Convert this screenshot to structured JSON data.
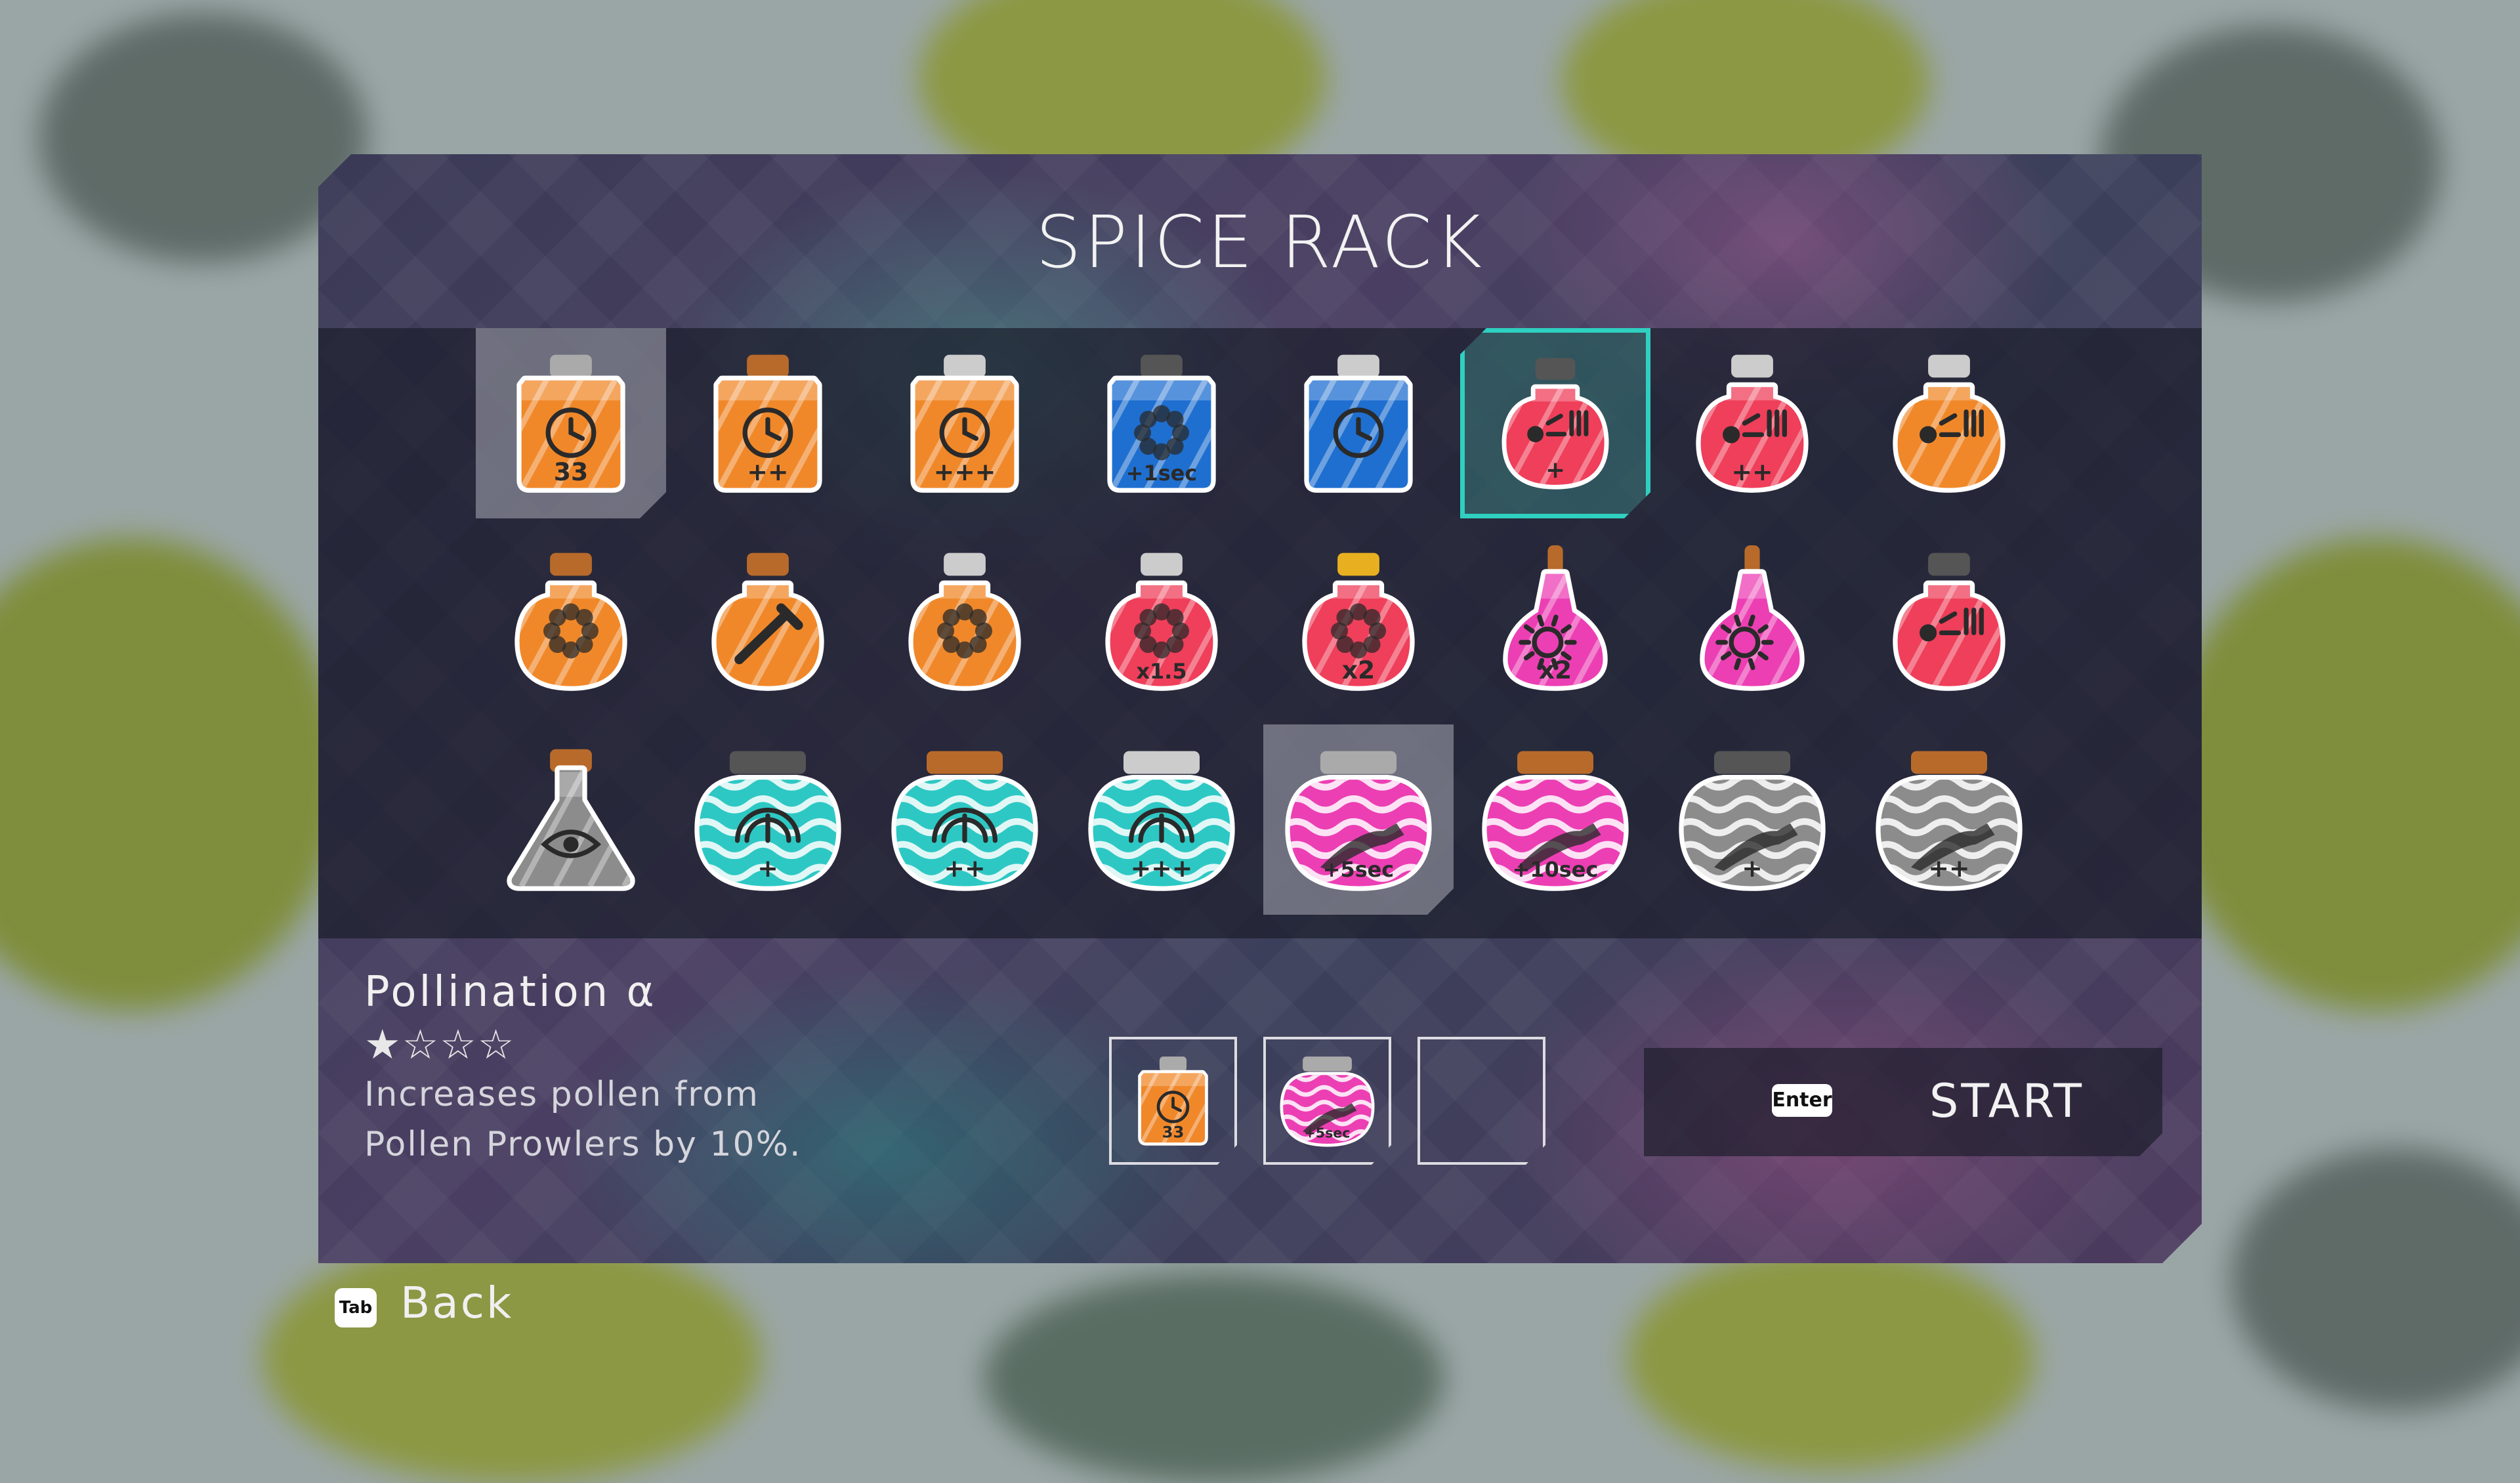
{
  "title": "SPICE RACK",
  "colors": {
    "accent_select": "#2fd0c0",
    "orange_potion": "#f0882a",
    "blue_potion": "#1f6fd0",
    "red_potion": "#ef3f5a",
    "pink_potion": "#ec3fb4",
    "teal_potion": "#2ec8c4",
    "gray_potion": "#8c8c8c"
  },
  "spices": [
    {
      "row": 0,
      "col": 0,
      "shape": "square",
      "color": "#f0882a",
      "cap": "#aaaaaa",
      "icon": "clock-icon",
      "badge": "33",
      "state": "hover"
    },
    {
      "row": 0,
      "col": 1,
      "shape": "square",
      "color": "#f0882a",
      "cap": "#b86a2a",
      "icon": "clock-icon",
      "badge": "++",
      "state": ""
    },
    {
      "row": 0,
      "col": 2,
      "shape": "square",
      "color": "#f0882a",
      "cap": "#cccccc",
      "icon": "clock-icon",
      "badge": "+++",
      "state": ""
    },
    {
      "row": 0,
      "col": 3,
      "shape": "square",
      "color": "#1f6fd0",
      "cap": "#555555",
      "icon": "flower-icon",
      "badge": "+1sec",
      "state": ""
    },
    {
      "row": 0,
      "col": 4,
      "shape": "square",
      "color": "#1f6fd0",
      "cap": "#cccccc",
      "icon": "clock-icon",
      "badge": "",
      "state": ""
    },
    {
      "row": 0,
      "col": 5,
      "shape": "round",
      "color": "#ef3f5a",
      "cap": "#555555",
      "icon": "pollen-icon",
      "badge": "+",
      "state": "selected"
    },
    {
      "row": 0,
      "col": 6,
      "shape": "round",
      "color": "#ef3f5a",
      "cap": "#cccccc",
      "icon": "pollen-icon",
      "badge": "++",
      "state": ""
    },
    {
      "row": 0,
      "col": 7,
      "shape": "round",
      "color": "#f0882a",
      "cap": "#cccccc",
      "icon": "pollen-icon",
      "badge": "",
      "state": ""
    },
    {
      "row": 1,
      "col": 0,
      "shape": "round",
      "color": "#f0882a",
      "cap": "#b86a2a",
      "icon": "flower-icon",
      "badge": "",
      "state": ""
    },
    {
      "row": 1,
      "col": 1,
      "shape": "round",
      "color": "#f0882a",
      "cap": "#b86a2a",
      "icon": "dropper-icon",
      "badge": "",
      "state": ""
    },
    {
      "row": 1,
      "col": 2,
      "shape": "round",
      "color": "#f0882a",
      "cap": "#cccccc",
      "icon": "flower-icon",
      "badge": "",
      "state": ""
    },
    {
      "row": 1,
      "col": 3,
      "shape": "round",
      "color": "#ef3f5a",
      "cap": "#cccccc",
      "icon": "flower-icon",
      "badge": "x1.5",
      "state": ""
    },
    {
      "row": 1,
      "col": 4,
      "shape": "round",
      "color": "#ef3f5a",
      "cap": "#e8b020",
      "icon": "flower-icon",
      "badge": "x2",
      "state": ""
    },
    {
      "row": 1,
      "col": 5,
      "shape": "cone",
      "color": "#ec3fb4",
      "cap": "#b86a2a",
      "icon": "sun-icon",
      "badge": "x2",
      "state": ""
    },
    {
      "row": 1,
      "col": 6,
      "shape": "cone",
      "color": "#ec3fb4",
      "cap": "#b86a2a",
      "icon": "sun-icon",
      "badge": "",
      "state": ""
    },
    {
      "row": 1,
      "col": 7,
      "shape": "round",
      "color": "#ef3f5a",
      "cap": "#555555",
      "icon": "pollen-icon",
      "badge": "",
      "state": ""
    },
    {
      "row": 2,
      "col": 0,
      "shape": "flask",
      "color": "#8c8c8c",
      "cap": "#b86a2a",
      "icon": "eye-icon",
      "badge": "",
      "state": ""
    },
    {
      "row": 2,
      "col": 1,
      "shape": "wide",
      "color": "#2ec8c4",
      "cap": "#555555",
      "icon": "gauge-icon",
      "badge": "+",
      "state": ""
    },
    {
      "row": 2,
      "col": 2,
      "shape": "wide",
      "color": "#2ec8c4",
      "cap": "#b86a2a",
      "icon": "gauge-icon",
      "badge": "++",
      "state": ""
    },
    {
      "row": 2,
      "col": 3,
      "shape": "wide",
      "color": "#2ec8c4",
      "cap": "#cccccc",
      "icon": "gauge-icon",
      "badge": "+++",
      "state": ""
    },
    {
      "row": 2,
      "col": 4,
      "shape": "wide",
      "color": "#ec3fb4",
      "cap": "#aaaaaa",
      "icon": "shoe-icon",
      "badge": "+5sec",
      "state": "hover"
    },
    {
      "row": 2,
      "col": 5,
      "shape": "wide",
      "color": "#ec3fb4",
      "cap": "#b86a2a",
      "icon": "shoe-icon",
      "badge": "+10sec",
      "state": ""
    },
    {
      "row": 2,
      "col": 6,
      "shape": "wide",
      "color": "#8c8c8c",
      "cap": "#555555",
      "icon": "shoe-icon",
      "badge": "+",
      "state": ""
    },
    {
      "row": 2,
      "col": 7,
      "shape": "wide",
      "color": "#8c8c8c",
      "cap": "#b86a2a",
      "icon": "shoe-icon",
      "badge": "++",
      "state": ""
    }
  ],
  "info": {
    "name": "Pollination α",
    "stars": "★☆☆☆",
    "desc_line1": "Increases pollen from",
    "desc_line2": "Pollen Prowlers by 10%."
  },
  "loadout": [
    {
      "shape": "square",
      "color": "#f0882a",
      "cap": "#aaaaaa",
      "icon": "clock-icon",
      "badge": "33"
    },
    {
      "shape": "wide",
      "color": "#ec3fb4",
      "cap": "#aaaaaa",
      "icon": "shoe-icon",
      "badge": "+5sec"
    },
    null
  ],
  "start": {
    "key": "Enter",
    "label": "START"
  },
  "back": {
    "key": "Tab",
    "label": "Back"
  }
}
